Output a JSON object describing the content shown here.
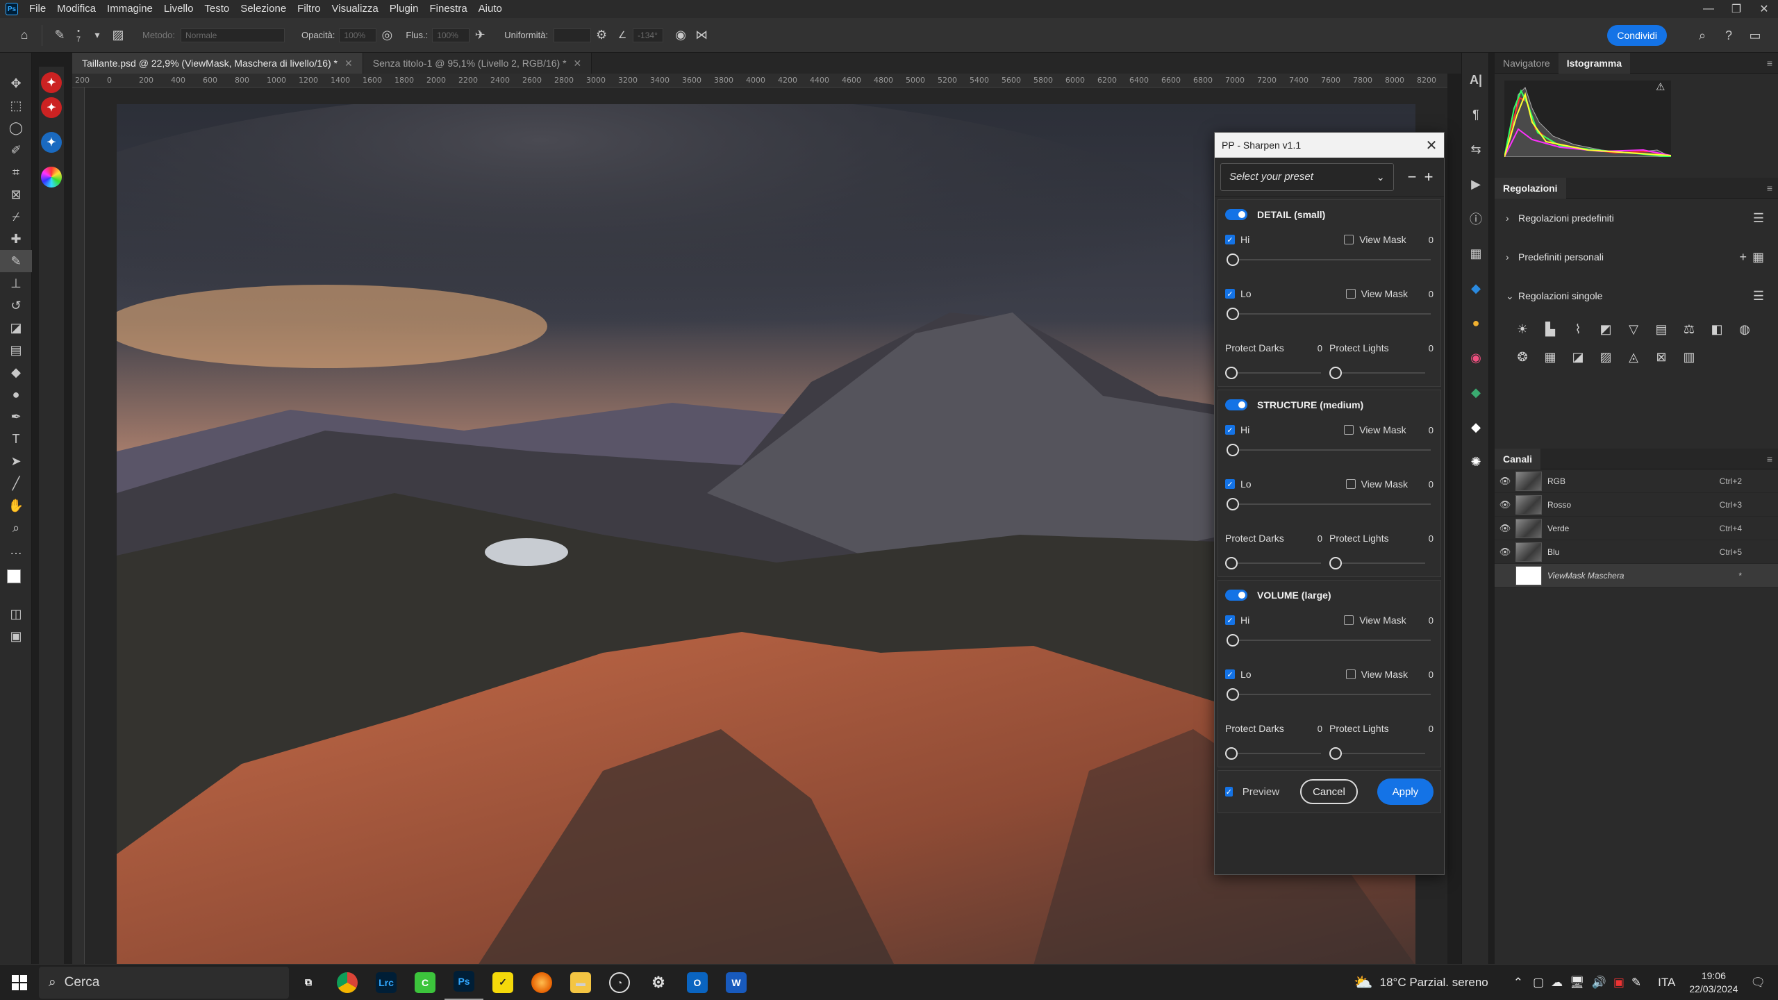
{
  "menubar": {
    "items": [
      "File",
      "Modifica",
      "Immagine",
      "Livello",
      "Testo",
      "Selezione",
      "Filtro",
      "Visualizza",
      "Plugin",
      "Finestra",
      "Aiuto"
    ]
  },
  "options": {
    "brush_size": "7",
    "method_label": "Metodo:",
    "method_value": "Normale",
    "opacity_label": "Opacità:",
    "opacity_value": "100%",
    "flow_label": "Flus.:",
    "flow_value": "100%",
    "smooth_label": "Uniformità:",
    "angle_value": "-134°",
    "share_label": "Condividi"
  },
  "tabs": [
    {
      "label": "Taillante.psd @ 22,9% (ViewMask, Maschera di livello/16) *",
      "active": true
    },
    {
      "label": "Senza titolo-1 @ 95,1% (Livello 2, RGB/16) *",
      "active": false
    }
  ],
  "ruler": [
    "200",
    "0",
    "200",
    "400",
    "600",
    "800",
    "1000",
    "1200",
    "1400",
    "1600",
    "1800",
    "2000",
    "2200",
    "2400",
    "2600",
    "2800",
    "3000",
    "3200",
    "3400",
    "3600",
    "3800",
    "4000",
    "4200",
    "4400",
    "4600",
    "4800",
    "5000",
    "5200",
    "5400",
    "5600",
    "5800",
    "6000",
    "6200",
    "6400",
    "6600",
    "6800",
    "7000",
    "7200",
    "7400",
    "7600",
    "7800",
    "8000",
    "8200"
  ],
  "dialog": {
    "title": "PP - Sharpen v1.1",
    "preset_placeholder": "Select your preset",
    "sections": [
      {
        "title": "DETAIL (small)",
        "hi_label": "Hi",
        "lo_label": "Lo",
        "view_mask": "View Mask",
        "hi_val": "0",
        "lo_val": "0",
        "pd_label": "Protect Darks",
        "pd_val": "0",
        "pl_label": "Protect Lights",
        "pl_val": "0"
      },
      {
        "title": "STRUCTURE (medium)",
        "hi_label": "Hi",
        "lo_label": "Lo",
        "view_mask": "View Mask",
        "hi_val": "0",
        "lo_val": "0",
        "pd_label": "Protect Darks",
        "pd_val": "0",
        "pl_label": "Protect Lights",
        "pl_val": "0"
      },
      {
        "title": "VOLUME (large)",
        "hi_label": "Hi",
        "lo_label": "Lo",
        "view_mask": "View Mask",
        "hi_val": "0",
        "lo_val": "0",
        "pd_label": "Protect Darks",
        "pd_val": "0",
        "pl_label": "Protect Lights",
        "pl_val": "0"
      }
    ],
    "preview_label": "Preview",
    "cancel_label": "Cancel",
    "apply_label": "Apply"
  },
  "panels": {
    "top_tabs": [
      "Navigatore",
      "Istogramma"
    ],
    "adjustments_title": "Regolazioni",
    "adjust_rows": [
      "Regolazioni predefiniti",
      "Predefiniti personali",
      "Regolazioni singole"
    ],
    "channels_title": "Canali",
    "channels": [
      {
        "name": "RGB",
        "shortcut": "Ctrl+2"
      },
      {
        "name": "Rosso",
        "shortcut": "Ctrl+3"
      },
      {
        "name": "Verde",
        "shortcut": "Ctrl+4"
      },
      {
        "name": "Blu",
        "shortcut": "Ctrl+5"
      },
      {
        "name": "ViewMask Maschera",
        "shortcut": "*"
      }
    ]
  },
  "taskbar": {
    "search_placeholder": "Cerca",
    "weather": "18°C  Parzial. sereno",
    "language": "ITA",
    "time": "19:06",
    "date": "22/03/2024",
    "apps": [
      "lrc",
      "ps"
    ]
  },
  "colors": {
    "accent": "#1473e6",
    "dialog_bg": "#2a2a2a",
    "panel_bg": "#2b2b2b"
  }
}
